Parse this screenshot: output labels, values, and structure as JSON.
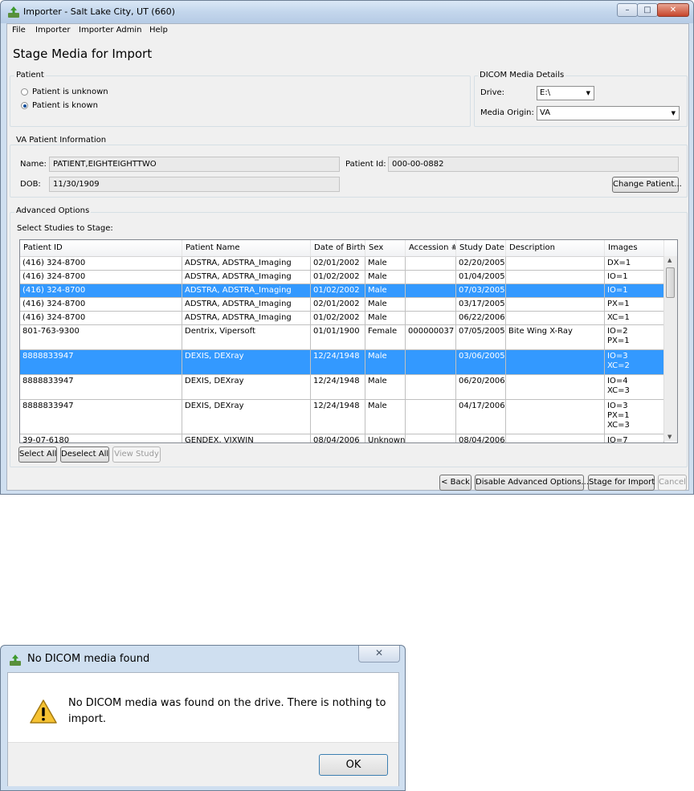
{
  "window": {
    "title": "Importer - Salt Lake City, UT (660)",
    "caption_buttons": [
      "minimize",
      "maximize",
      "close"
    ],
    "caption_glyphs": {
      "minimize": "–",
      "maximize": "□",
      "close": "✕"
    }
  },
  "menu": [
    "File",
    "Importer",
    "Importer Admin",
    "Help"
  ],
  "page_title": "Stage Media for Import",
  "patient_group": {
    "legend": "Patient",
    "options": [
      {
        "label": "Patient is unknown",
        "selected": false
      },
      {
        "label": "Patient is known",
        "selected": true
      }
    ]
  },
  "dicom_group": {
    "legend": "DICOM Media Details",
    "drive_label": "Drive:",
    "drive_value": "E:\\",
    "origin_label": "Media Origin:",
    "origin_value": "VA"
  },
  "va_patient": {
    "legend": "VA Patient Information",
    "name_label": "Name:",
    "name_value": "PATIENT,EIGHTEIGHTTWO",
    "dob_label": "DOB:",
    "dob_value": "11/30/1909",
    "id_label": "Patient Id:",
    "id_value": "000-00-0882",
    "change_button": "Change Patient..."
  },
  "advanced": {
    "legend": "Advanced Options",
    "select_label": "Select Studies to Stage:",
    "columns": [
      "Patient ID",
      "Patient Name",
      "Date of Birth",
      "Sex",
      "Accession #",
      "Study Date",
      "Description",
      "Images"
    ],
    "rows": [
      {
        "selected": false,
        "cells": [
          "(416) 324-8700",
          "ADSTRA, ADSTRA_Imaging",
          "02/01/2002",
          "Male",
          "",
          "02/20/2005",
          "",
          "DX=1"
        ]
      },
      {
        "selected": false,
        "cells": [
          "(416) 324-8700",
          "ADSTRA, ADSTRA_Imaging",
          "01/02/2002",
          "Male",
          "",
          "01/04/2005",
          "",
          "IO=1"
        ]
      },
      {
        "selected": true,
        "cells": [
          "(416) 324-8700",
          "ADSTRA, ADSTRA_Imaging",
          "01/02/2002",
          "Male",
          "",
          "07/03/2005",
          "",
          "IO=1"
        ]
      },
      {
        "selected": false,
        "cells": [
          "(416) 324-8700",
          "ADSTRA, ADSTRA_Imaging",
          "02/01/2002",
          "Male",
          "",
          "03/17/2005",
          "",
          "PX=1"
        ]
      },
      {
        "selected": false,
        "cells": [
          "(416) 324-8700",
          "ADSTRA, ADSTRA_Imaging",
          "01/02/2002",
          "Male",
          "",
          "06/22/2006",
          "",
          "XC=1"
        ]
      },
      {
        "selected": false,
        "cells": [
          "801-763-9300",
          "Dentrix, Vipersoft",
          "01/01/1900",
          "Female",
          "000000037",
          "07/05/2005",
          "Bite Wing X-Ray",
          "IO=2\nPX=1"
        ]
      },
      {
        "selected": true,
        "cells": [
          "8888833947",
          "DEXIS, DEXray",
          "12/24/1948",
          "Male",
          "",
          "03/06/2005",
          "",
          "IO=3\nXC=2"
        ]
      },
      {
        "selected": false,
        "cells": [
          "8888833947",
          "DEXIS, DEXray",
          "12/24/1948",
          "Male",
          "",
          "06/20/2006",
          "",
          "IO=4\nXC=3"
        ]
      },
      {
        "selected": false,
        "cells": [
          "8888833947",
          "DEXIS, DEXray",
          "12/24/1948",
          "Male",
          "",
          "04/17/2006",
          "",
          "IO=3\nPX=1\nXC=3"
        ]
      },
      {
        "selected": false,
        "cells": [
          "39-07-6180",
          "GENDEX, VIXWIN",
          "08/04/2006",
          "Unknown",
          "",
          "08/04/2006",
          "",
          "IO=7"
        ]
      }
    ],
    "select_all": "Select All",
    "deselect_all": "Deselect All",
    "view_study": "View Study"
  },
  "footer_buttons": {
    "back": "< Back",
    "disable_advanced": "Disable Advanced Options...",
    "stage": "Stage for Import",
    "cancel": "Cancel"
  },
  "dialog": {
    "title": "No DICOM media found",
    "message": "No DICOM media was found on the drive. There is nothing to import.",
    "ok": "OK",
    "close_glyph": "✕"
  }
}
